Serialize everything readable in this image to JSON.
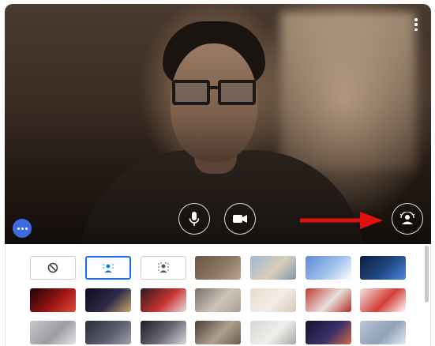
{
  "preview": {
    "name": "camera-preview",
    "controls": {
      "more_icon": "more-vert-icon",
      "mic_icon": "microphone-icon",
      "camera_icon": "video-camera-icon",
      "effects_icon": "visual-effects-icon",
      "overflow_icon": "more-horiz-icon"
    },
    "accent_color": "#1a73e8",
    "arrow_color": "#e01010"
  },
  "effects": {
    "options": [
      {
        "name": "no-effect",
        "icon": "block-icon",
        "selected": false
      },
      {
        "name": "slight-blur",
        "icon": "blur-person-icon",
        "selected": true
      },
      {
        "name": "full-blur",
        "icon": "blur-background-icon",
        "selected": false
      }
    ],
    "backgrounds": [
      {
        "name": "brown-landscape",
        "colors": [
          "#6a5646",
          "#8c7763",
          "#b9a58e"
        ]
      },
      {
        "name": "beach-sky",
        "colors": [
          "#9cb8d6",
          "#d9cdb9",
          "#7f95ad"
        ]
      },
      {
        "name": "blue-clouds",
        "colors": [
          "#5e8bd1",
          "#9fc0eb",
          "#ffffff"
        ]
      },
      {
        "name": "night-tech",
        "colors": [
          "#0e1c3c",
          "#1f4a86",
          "#4f86d8"
        ]
      },
      {
        "name": "red-fireworks",
        "colors": [
          "#170505",
          "#9a1414",
          "#e04a3a"
        ]
      },
      {
        "name": "dark-fireworks",
        "colors": [
          "#0a0a18",
          "#2f2a4a",
          "#c8a86a"
        ]
      },
      {
        "name": "red-flowers",
        "colors": [
          "#2a1c1c",
          "#c83232",
          "#e8dede"
        ]
      },
      {
        "name": "pebbles",
        "colors": [
          "#7a6e66",
          "#cfc4ba",
          "#a89d94"
        ]
      },
      {
        "name": "cream-room",
        "colors": [
          "#e8dbcf",
          "#f4ede6",
          "#d8c7b7"
        ]
      },
      {
        "name": "red-pattern",
        "colors": [
          "#c23a32",
          "#e6e1dc",
          "#b52a25"
        ]
      },
      {
        "name": "red-dots",
        "colors": [
          "#f1e6e4",
          "#d33d36",
          "#ffffff"
        ]
      },
      {
        "name": "white-interior",
        "colors": [
          "#c8c8cc",
          "#9c9ca3",
          "#e4e4e8"
        ]
      },
      {
        "name": "dark-office",
        "colors": [
          "#2b2d3a",
          "#595c6b",
          "#9da0ad"
        ]
      },
      {
        "name": "dim-room",
        "colors": [
          "#1c1c22",
          "#6b6b78",
          "#d9d9e0"
        ]
      },
      {
        "name": "shelves",
        "colors": [
          "#4a3e35",
          "#b0a090",
          "#6b5b4e"
        ]
      },
      {
        "name": "white-shelf",
        "colors": [
          "#d8d6d2",
          "#f0efec",
          "#a9a6a0"
        ]
      },
      {
        "name": "city-night",
        "colors": [
          "#12142a",
          "#39306a",
          "#cf6b4a"
        ]
      },
      {
        "name": "light-room",
        "colors": [
          "#bdc7d4",
          "#8ea0b8",
          "#e6ebf2"
        ]
      }
    ]
  }
}
